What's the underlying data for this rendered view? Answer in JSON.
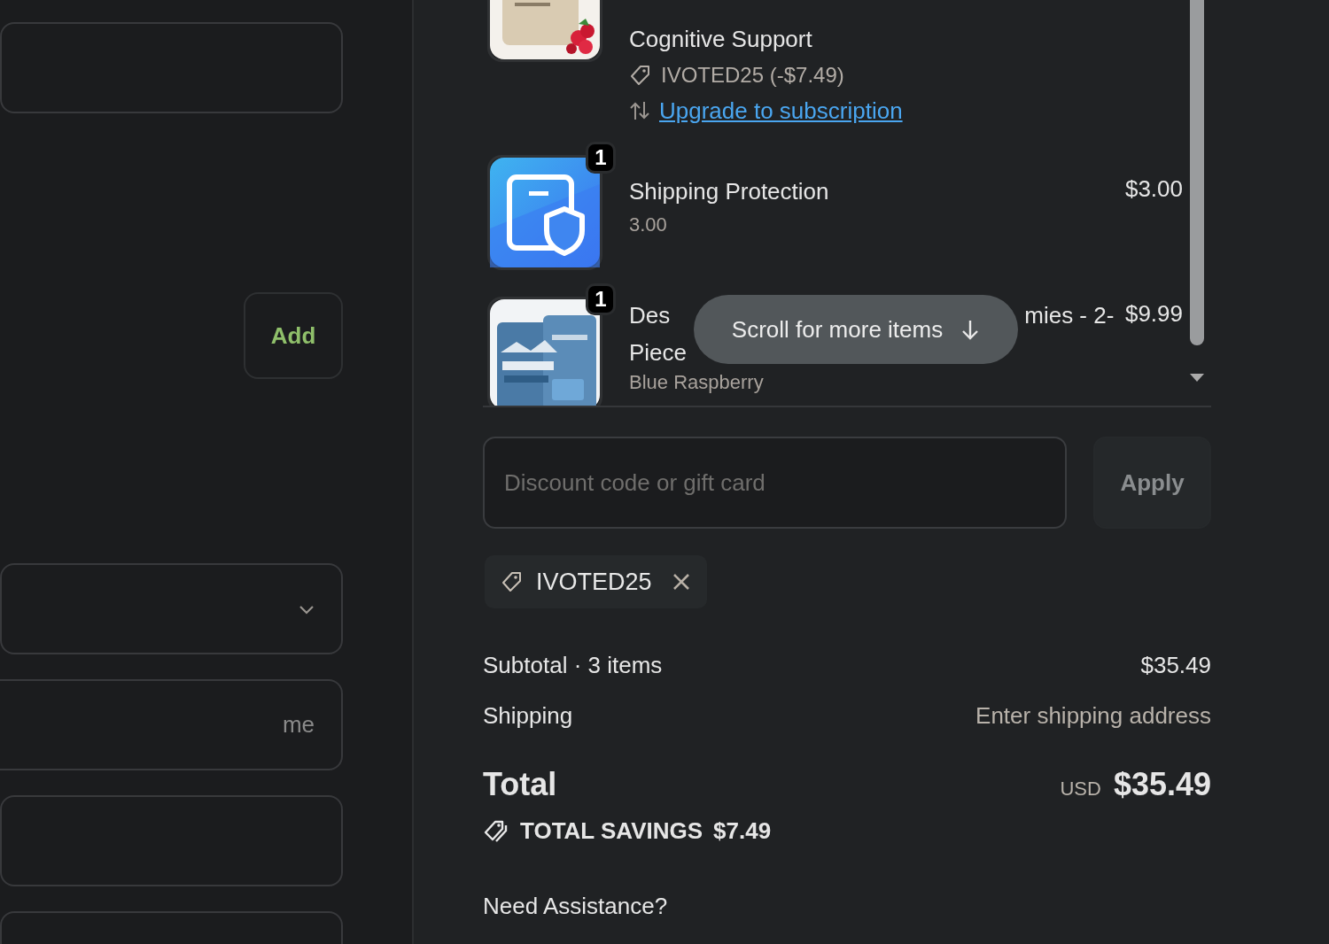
{
  "form": {
    "fields": [
      {
        "kind": "text"
      },
      {
        "kind": "button",
        "label": "Add"
      },
      {
        "kind": "select"
      },
      {
        "kind": "text",
        "placeholder": "me"
      },
      {
        "kind": "text"
      },
      {
        "kind": "text"
      }
    ]
  },
  "cart": {
    "items": [
      {
        "kind": "continued",
        "title_lines": [
          [
            "Cognitive Support"
          ]
        ],
        "discount": "IVOTED25 (-$7.49)",
        "action": "Upgrade to subscription"
      },
      {
        "kind": "full",
        "quantity": "1",
        "title_lines": [
          [
            "Shipping Protection"
          ]
        ],
        "variant": "3.00",
        "price": "$3.00"
      },
      {
        "kind": "full",
        "quantity": "1",
        "title_lines": [
          [
            "Des",
            "mies - 2-"
          ],
          [
            "Piece"
          ]
        ],
        "variant": "Blue Raspberry",
        "price": "$9.99"
      }
    ],
    "scroll_hint": "Scroll for more items"
  },
  "discount": {
    "placeholder": "Discount code or gift card",
    "button": "Apply",
    "applied": [
      {
        "code": "IVOTED25"
      }
    ]
  },
  "summary": {
    "rows": [
      {
        "label": "Subtotal · 3 items",
        "value": "$35.49",
        "muted": false
      },
      {
        "label": "Shipping",
        "value": "Enter shipping address",
        "muted": true
      }
    ],
    "total": {
      "label": "Total",
      "currency": "USD",
      "value": "$35.49"
    },
    "savings": {
      "label": "TOTAL SAVINGS",
      "value": "$7.49"
    }
  },
  "help": "Need Assistance?"
}
